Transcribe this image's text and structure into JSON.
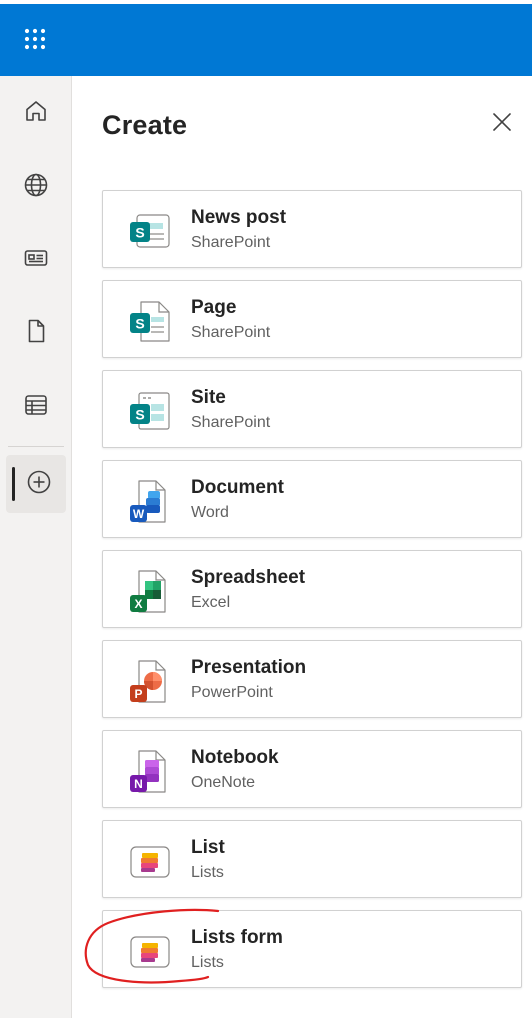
{
  "topbar": {
    "app_launcher_icon": "waffle-grid-icon",
    "color": "#0078d4"
  },
  "rail": {
    "items": [
      {
        "name": "home",
        "icon": "home-icon"
      },
      {
        "name": "sites",
        "icon": "globe-icon"
      },
      {
        "name": "news",
        "icon": "news-icon"
      },
      {
        "name": "files",
        "icon": "file-icon"
      },
      {
        "name": "lists",
        "icon": "list-table-icon"
      },
      {
        "name": "create",
        "icon": "add-circle-icon",
        "active": true
      }
    ]
  },
  "panel": {
    "title": "Create",
    "close_icon": "close-icon",
    "items": [
      {
        "name": "News post",
        "app": "SharePoint",
        "icon": "sharepoint-news-icon",
        "color": "#038387"
      },
      {
        "name": "Page",
        "app": "SharePoint",
        "icon": "sharepoint-page-icon",
        "color": "#038387"
      },
      {
        "name": "Site",
        "app": "SharePoint",
        "icon": "sharepoint-site-icon",
        "color": "#038387"
      },
      {
        "name": "Document",
        "app": "Word",
        "icon": "word-icon",
        "color": "#185abd"
      },
      {
        "name": "Spreadsheet",
        "app": "Excel",
        "icon": "excel-icon",
        "color": "#107c41"
      },
      {
        "name": "Presentation",
        "app": "PowerPoint",
        "icon": "powerpoint-icon",
        "color": "#c43e1c"
      },
      {
        "name": "Notebook",
        "app": "OneNote",
        "icon": "onenote-icon",
        "color": "#7719aa"
      },
      {
        "name": "List",
        "app": "Lists",
        "icon": "lists-icon",
        "color": "#e8467c"
      },
      {
        "name": "Lists form",
        "app": "Lists",
        "icon": "lists-form-icon",
        "color": "#e8467c"
      }
    ]
  },
  "annotation": {
    "color": "#e02020"
  }
}
